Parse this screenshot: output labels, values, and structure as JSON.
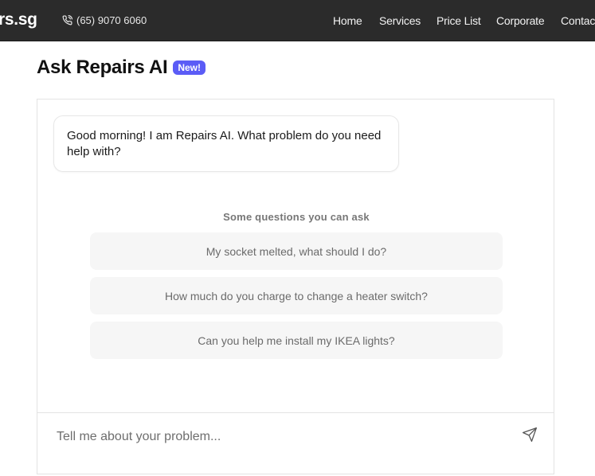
{
  "header": {
    "brand": "rs.sg",
    "phone": "(65) 9070 6060",
    "nav": [
      "Home",
      "Services",
      "Price List",
      "Corporate",
      "Contact"
    ]
  },
  "page": {
    "title": "Ask Repairs AI",
    "badge": "New!"
  },
  "chat": {
    "greeting": "Good morning! I am Repairs AI. What problem do you need help with?",
    "suggestions_heading": "Some questions you can ask",
    "suggestions": [
      "My socket melted, what should I do?",
      "How much do you charge to change a heater switch?",
      "Can you help me install my IKEA lights?"
    ],
    "input_placeholder": "Tell me about your problem...",
    "input_value": ""
  },
  "colors": {
    "topbar": "#2b2b2b",
    "badge": "#5b5cf6",
    "suggestion_bg": "#f6f6f6"
  },
  "icons": {
    "phone": "phone-icon",
    "send": "send-icon"
  }
}
